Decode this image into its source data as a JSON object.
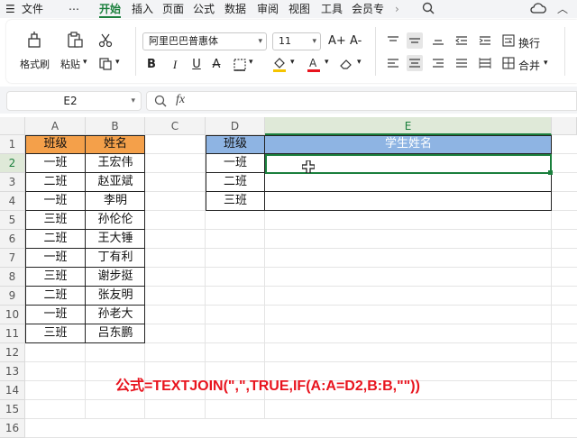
{
  "menubar": {
    "items": [
      "文件",
      "⋯",
      "开始",
      "插入",
      "页面",
      "公式",
      "数据",
      "审阅",
      "视图",
      "工具",
      "会员专"
    ],
    "active_index": 2,
    "accent": "#1a7f3c"
  },
  "ribbon": {
    "format_painter_label": "格式刷",
    "paste_label": "粘贴",
    "font_name": "阿里巴巴普惠体",
    "font_size": "11",
    "grow_font": "A+",
    "shrink_font": "A-",
    "bold": "B",
    "italic": "I",
    "underline": "U",
    "wrap_text_label": "换行",
    "merge_label": "合并",
    "font_color": "#e8141e"
  },
  "formula_bar": {
    "cell_ref": "E2",
    "formula": ""
  },
  "sheet": {
    "columns": [
      "A",
      "B",
      "C",
      "D",
      "E"
    ],
    "rows": [
      "1",
      "2",
      "3",
      "4",
      "5",
      "6",
      "7",
      "8",
      "9",
      "10",
      "11",
      "12",
      "13",
      "14",
      "15",
      "16"
    ],
    "active_cell": "E2",
    "header_fill_left": "#f4a04a",
    "header_fill_right": "#8eb4e3",
    "selection_color": "#1a7f3c",
    "table1": {
      "headers": [
        "班级",
        "姓名"
      ],
      "rows": [
        [
          "一班",
          "王宏伟"
        ],
        [
          "二班",
          "赵亚斌"
        ],
        [
          "一班",
          "李明"
        ],
        [
          "三班",
          "孙伦伦"
        ],
        [
          "二班",
          "王大锤"
        ],
        [
          "一班",
          "丁有利"
        ],
        [
          "三班",
          "谢步挺"
        ],
        [
          "二班",
          "张友明"
        ],
        [
          "一班",
          "孙老大"
        ],
        [
          "三班",
          "吕东鹏"
        ]
      ]
    },
    "table2": {
      "headers": [
        "班级",
        "学生姓名"
      ],
      "rows": [
        [
          "一班",
          ""
        ],
        [
          "二班",
          ""
        ],
        [
          "三班",
          ""
        ]
      ]
    }
  },
  "annotation": "公式=TEXTJOIN(\",\",TRUE,IF(A:A=D2,B:B,\"\"))"
}
